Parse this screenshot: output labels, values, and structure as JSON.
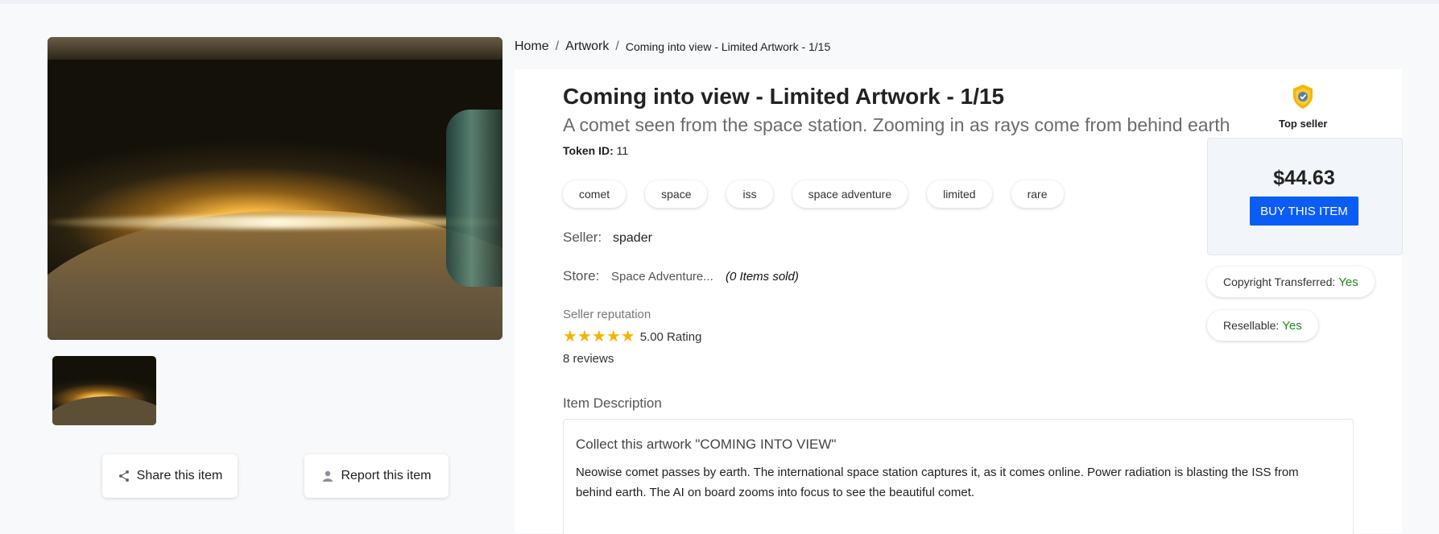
{
  "breadcrumb": {
    "home": "Home",
    "artwork": "Artwork",
    "current": "Coming into view - Limited Artwork - 1/15"
  },
  "item": {
    "title": "Coming into view - Limited Artwork - 1/15",
    "subtitle": "A comet seen from the space station. Zooming in as rays come from behind earth",
    "token_label": "Token ID:",
    "token_id": "11",
    "tags": [
      "comet",
      "space",
      "iss",
      "space adventure",
      "limited",
      "rare"
    ]
  },
  "seller": {
    "label": "Seller:",
    "name": "spader",
    "store_label": "Store:",
    "store_name": "Space Adventure...",
    "store_sold": "(0 Items sold)",
    "reputation_label": "Seller reputation",
    "stars": 5,
    "rating_text": "5.00 Rating",
    "reviews_text": "8 reviews"
  },
  "description": {
    "label": "Item Description",
    "heading": "Collect this artwork \"COMING INTO VIEW\"",
    "text": "Neowise comet passes by earth. The international space station captures it, as it comes online. Power radiation is blasting the ISS from behind earth. The AI on board zooms into focus to see the beautiful comet."
  },
  "purchase": {
    "badge_icon": "shield-check-icon",
    "badge_label": "Top seller",
    "price": "$44.63",
    "buy_label": "BUY THIS ITEM",
    "copyright_label": "Copyright Transferred:",
    "copyright_value": "Yes",
    "resellable_label": "Resellable:",
    "resellable_value": "Yes"
  },
  "actions": {
    "share_label": "Share this item",
    "share_icon": "share-icon",
    "report_label": "Report this item",
    "report_icon": "user-icon"
  },
  "colors": {
    "accent": "#0a5cf5",
    "yes_green": "#1d8a1d",
    "star": "#f5b301",
    "badge": "#f2b705"
  }
}
